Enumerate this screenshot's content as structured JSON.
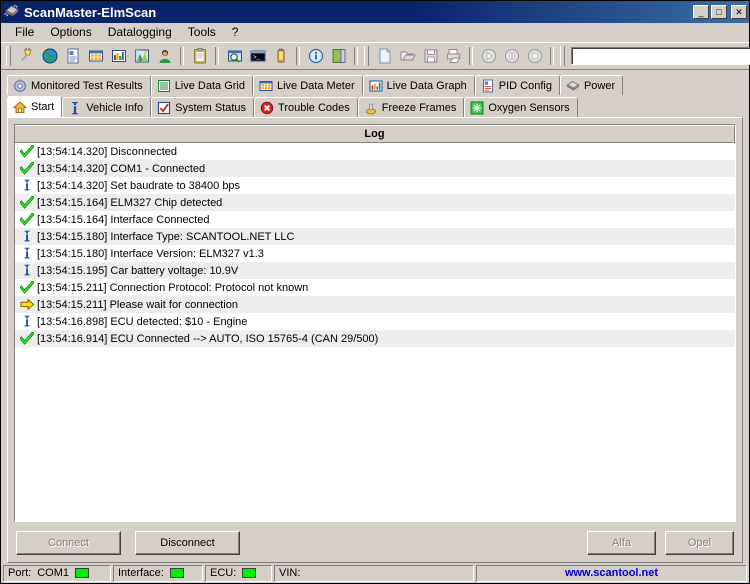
{
  "window": {
    "title": "ScanMaster-ElmScan",
    "icon": "chip-icon",
    "controls": [
      {
        "name": "minimize-button",
        "glyph": "_"
      },
      {
        "name": "maximize-button",
        "glyph": "□"
      },
      {
        "name": "close-button",
        "glyph": "✕"
      }
    ]
  },
  "menu": {
    "items": [
      {
        "label": "File"
      },
      {
        "label": "Options"
      },
      {
        "label": "Datalogging"
      },
      {
        "label": "Tools"
      },
      {
        "label": "?"
      }
    ]
  },
  "toolbar": {
    "buttons": [
      {
        "name": "connect-plug-icon"
      },
      {
        "name": "globe-icon"
      },
      {
        "name": "report-icon"
      },
      {
        "name": "grid-icon"
      },
      {
        "name": "chart-icon"
      },
      {
        "name": "graph-image-icon"
      },
      {
        "name": "user-icon"
      },
      {
        "name": "clipboard-icon"
      },
      {
        "name": "inspect-icon"
      },
      {
        "name": "terminal-icon"
      },
      {
        "name": "battery-icon"
      },
      {
        "name": "info-icon"
      },
      {
        "name": "exit-icon"
      },
      {
        "name": "new-file-icon"
      },
      {
        "name": "open-folder-icon"
      },
      {
        "name": "save-icon"
      },
      {
        "name": "print-icon"
      },
      {
        "name": "play-icon"
      },
      {
        "name": "pause-icon"
      },
      {
        "name": "stop-icon"
      }
    ],
    "search_value": "",
    "search_placeholder": ""
  },
  "tabs": {
    "row1": [
      {
        "label": "Monitored Test Results",
        "icon": "gear-icon",
        "active": false
      },
      {
        "label": "Live Data Grid",
        "icon": "list-grid-icon",
        "active": false
      },
      {
        "label": "Live Data Meter",
        "icon": "meter-icon",
        "active": false
      },
      {
        "label": "Live Data Graph",
        "icon": "bar-chart-icon",
        "active": false
      },
      {
        "label": "PID Config",
        "icon": "document-config-icon",
        "active": false
      },
      {
        "label": "Power",
        "icon": "power-chip-icon",
        "active": false
      }
    ],
    "row2": [
      {
        "label": "Start",
        "icon": "home-icon",
        "active": true
      },
      {
        "label": "Vehicle Info",
        "icon": "info-blue-icon",
        "active": false
      },
      {
        "label": "System Status",
        "icon": "checkbox-red-icon",
        "active": false
      },
      {
        "label": "Trouble Codes",
        "icon": "error-circle-icon",
        "active": false
      },
      {
        "label": "Freeze Frames",
        "icon": "snowman-icon",
        "active": false
      },
      {
        "label": "Oxygen Sensors",
        "icon": "green-sensor-icon",
        "active": false
      }
    ]
  },
  "log": {
    "header": "Log",
    "entries": [
      {
        "icon": "check-icon",
        "text": "[13:54:14.320] Disconnected"
      },
      {
        "icon": "check-icon",
        "text": "[13:54:14.320] COM1 - Connected"
      },
      {
        "icon": "info-icon",
        "text": "[13:54:14.320] Set baudrate to 38400 bps"
      },
      {
        "icon": "check-icon",
        "text": "[13:54:15.164] ELM327 Chip detected"
      },
      {
        "icon": "check-icon",
        "text": "[13:54:15.164] Interface Connected"
      },
      {
        "icon": "info-icon",
        "text": "[13:54:15.180] Interface Type: SCANTOOL.NET LLC"
      },
      {
        "icon": "info-icon",
        "text": "[13:54:15.180] Interface Version: ELM327 v1.3"
      },
      {
        "icon": "info-icon",
        "text": "[13:54:15.195] Car battery voltage: 10.9V"
      },
      {
        "icon": "check-icon",
        "text": "[13:54:15.211] Connection Protocol: Protocol not known"
      },
      {
        "icon": "arrow-icon",
        "text": "[13:54:15.211] Please wait for connection"
      },
      {
        "icon": "info-icon",
        "text": "[13:54:16.898] ECU detected: $10 - Engine"
      },
      {
        "icon": "check-icon",
        "text": "[13:54:16.914] ECU Connected --> AUTO, ISO 15765-4 (CAN 29/500)"
      }
    ]
  },
  "actions": {
    "connect": {
      "label": "Connect",
      "disabled": true
    },
    "disconnect": {
      "label": "Disconnect",
      "disabled": false
    },
    "alfa": {
      "label": "Alfa",
      "disabled": true
    },
    "opel": {
      "label": "Opel",
      "disabled": true
    }
  },
  "status": {
    "port_label": "Port:",
    "port_value": "COM1",
    "interface_label": "Interface:",
    "ecu_label": "ECU:",
    "vin_label": "VIN:",
    "vin_value": "",
    "url": "www.scantool.net",
    "led_color": "#00ee00"
  }
}
